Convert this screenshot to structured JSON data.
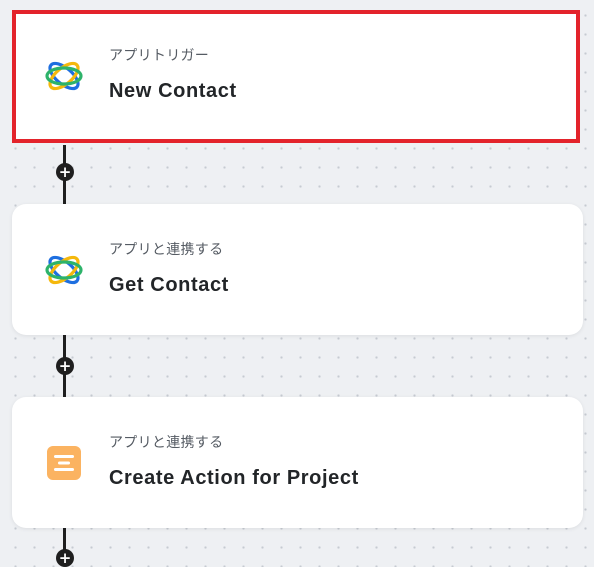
{
  "flow": {
    "steps": [
      {
        "label": "アプリトリガー",
        "title": "New Contact",
        "icon": "orbit-logo-icon",
        "selected": true
      },
      {
        "label": "アプリと連携する",
        "title": "Get Contact",
        "icon": "orbit-logo-icon",
        "selected": false
      },
      {
        "label": "アプリと連携する",
        "title": "Create Action for Project",
        "icon": "project-app-icon",
        "selected": false
      }
    ],
    "add_step_symbol": "+"
  },
  "colors": {
    "selection_border": "#e3232b",
    "connector": "#1f1f1f",
    "canvas_background": "#eef0f3",
    "canvas_dots": "#c6cad1",
    "card_background": "#ffffff",
    "orbit_blue": "#1e6fe0",
    "orbit_green": "#2db36a",
    "orbit_yellow": "#f5b80c",
    "project_icon_orange": "#fbb361"
  }
}
